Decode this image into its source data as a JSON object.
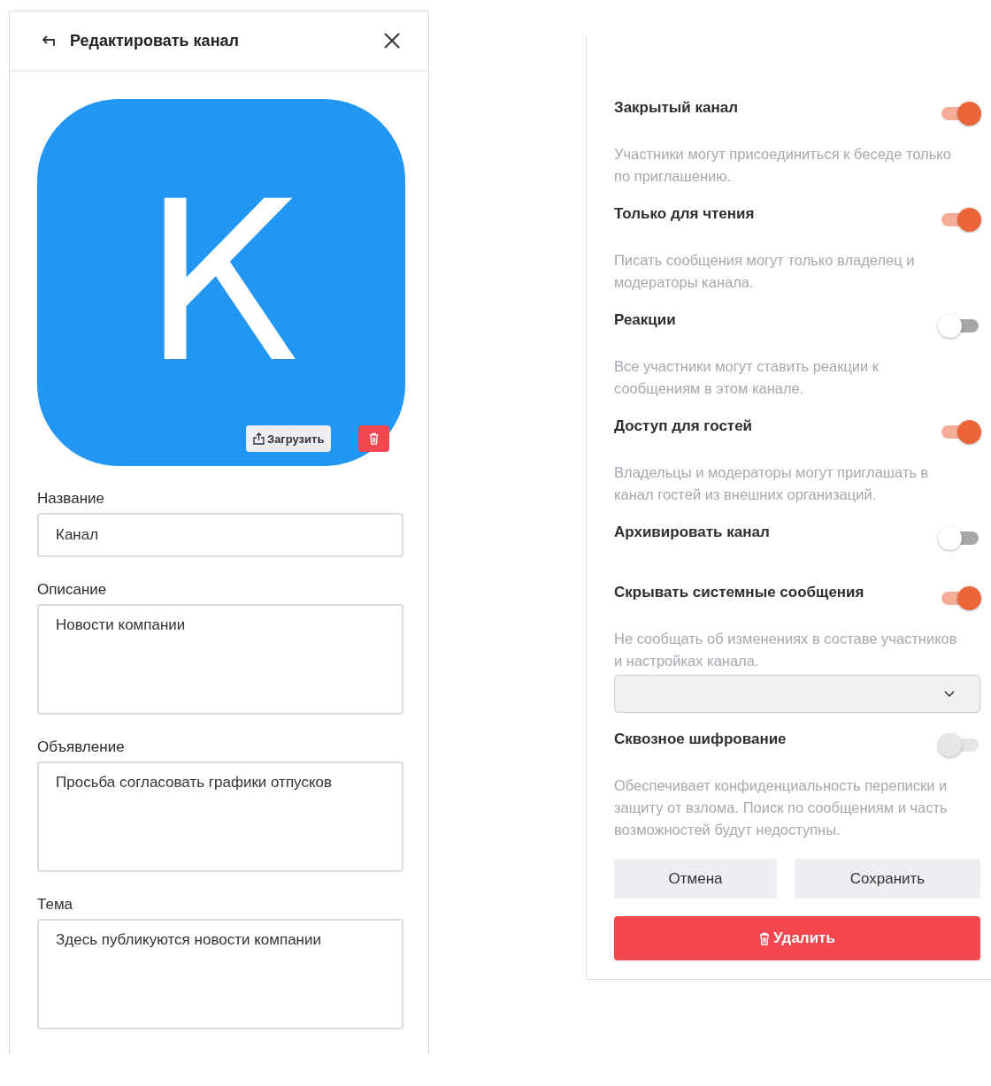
{
  "header": {
    "title": "Редактировать канал"
  },
  "avatar": {
    "letter": "К",
    "upload_label": "Загрузить"
  },
  "fields": [
    {
      "label": "Название",
      "value": "Канал",
      "kind": "input"
    },
    {
      "label": "Описание",
      "value": "Новости компании",
      "kind": "textarea"
    },
    {
      "label": "Объявление",
      "value": "Просьба согласовать графики отпусков",
      "kind": "textarea"
    },
    {
      "label": "Тема",
      "value": "Здесь публикуются новости компании",
      "kind": "textarea"
    }
  ],
  "settings": [
    {
      "label": "Закрытый канал",
      "on": true,
      "disabled": false,
      "description": "Участники могут присоединиться к беседе только по приглашению."
    },
    {
      "label": "Только для чтения",
      "on": true,
      "disabled": false,
      "description": "Писать сообщения могут только владелец и модераторы канала."
    },
    {
      "label": "Реакции",
      "on": false,
      "disabled": false,
      "description": "Все участники могут ставить реакции к сообщениям в этом канале."
    },
    {
      "label": "Доступ для гостей",
      "on": true,
      "disabled": false,
      "description": "Владельцы и модераторы могут приглашать в канал гостей из внешних организаций."
    },
    {
      "label": "Архивировать канал",
      "on": false,
      "disabled": false
    },
    {
      "label": "Скрывать системные сообщения",
      "on": true,
      "disabled": false,
      "description": "Не сообщать об изменениях в составе участников и настройках канала.",
      "dropdown": true
    },
    {
      "label": "Сквозное шифрование",
      "on": false,
      "disabled": true,
      "description": "Обеспечивает конфиденциальность переписки и защиту от взлома. Поиск по сообщениям и часть возможностей будут недоступны."
    }
  ],
  "buttons": {
    "cancel": "Отмена",
    "save": "Сохранить",
    "delete": "Удалить"
  }
}
